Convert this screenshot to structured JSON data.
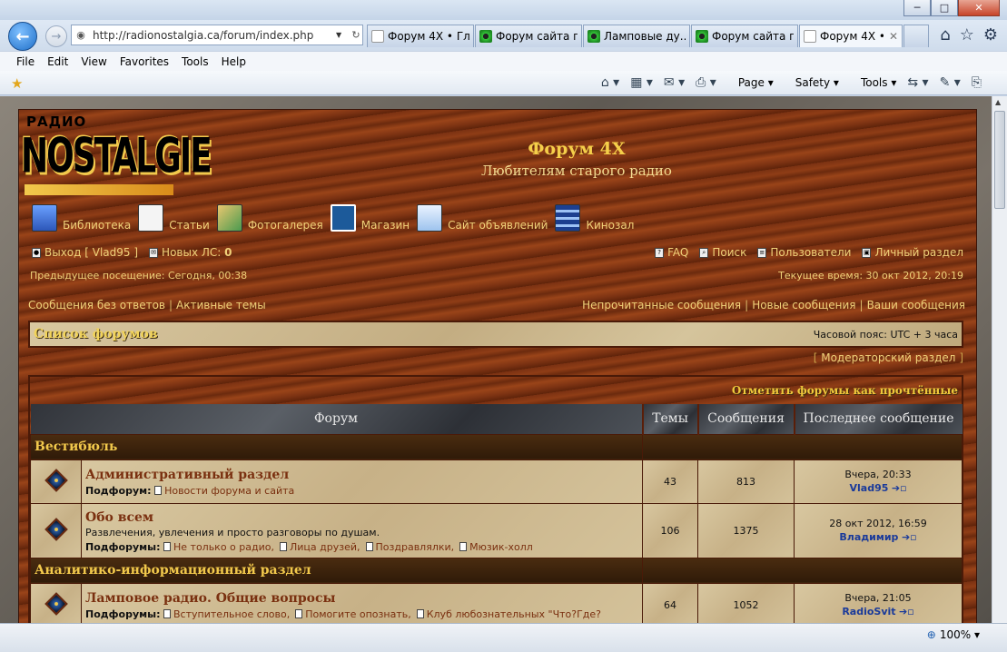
{
  "window": {
    "minimize": "─",
    "maximize": "□",
    "close": "✕"
  },
  "nav": {
    "back": "←",
    "forward": "→",
    "url": "http://radionostalgia.ca/forum/index.php"
  },
  "tabs": [
    {
      "label": "Форум 4Х • Гл...",
      "active": false,
      "fav": "w"
    },
    {
      "label": "Форум сайта г...",
      "active": false,
      "fav": "g"
    },
    {
      "label": "Ламповые ду...",
      "active": false,
      "fav": "g"
    },
    {
      "label": "Форум сайта г...",
      "active": false,
      "fav": "g"
    },
    {
      "label": "Форум 4Х •...",
      "active": true,
      "fav": "w"
    }
  ],
  "menu": [
    "File",
    "Edit",
    "View",
    "Favorites",
    "Tools",
    "Help"
  ],
  "commands": {
    "page": "Page",
    "safety": "Safety",
    "tools": "Tools"
  },
  "site": {
    "logo_small": "РАДИО",
    "logo_big": "NOSTALGIE",
    "title": "Форум 4Х",
    "description": "Любителям старого радио"
  },
  "mainnav": [
    {
      "name": "library",
      "label": "Библиотека",
      "icon": "lib"
    },
    {
      "name": "articles",
      "label": "Статьи",
      "icon": "art"
    },
    {
      "name": "gallery",
      "label": "Фотогалерея",
      "icon": "pho"
    },
    {
      "name": "shop",
      "label": "Магазин",
      "icon": "shop"
    },
    {
      "name": "ads",
      "label": "Сайт объявлений",
      "icon": "ads"
    },
    {
      "name": "cinema",
      "label": "Кинозал",
      "icon": "film"
    }
  ],
  "userbar": {
    "logout": "Выход [ Vlad95 ]",
    "new_pm_label": "Новых ЛС:",
    "new_pm_count": "0",
    "faq": "FAQ",
    "search": "Поиск",
    "members": "Пользователи",
    "ucp": "Личный раздел"
  },
  "visits": {
    "last_visit": "Предыдущее посещение: Сегодня, 00:38",
    "current_time": "Текущее время: 30 окт 2012, 20:19"
  },
  "quicklinks": {
    "unanswered": "Сообщения без ответов",
    "active": "Активные темы",
    "unread": "Непрочитанные сообщения",
    "new": "Новые сообщения",
    "own": "Ваши сообщения"
  },
  "crumbs": {
    "title": "Список форумов",
    "timezone": "Часовой пояс: UTC + 3 часа"
  },
  "moderator_link": "Модераторский раздел",
  "mark_read": "Отметить форумы как прочтённые",
  "table": {
    "headers": [
      "Форум",
      "Темы",
      "Сообщения",
      "Последнее сообщение"
    ],
    "cat1": "Вестибюль",
    "cat2": "Аналитико-информационный раздел",
    "forums": [
      {
        "name": "Административный раздел",
        "desc": "",
        "subs_label": "Подфорум:",
        "subs": [
          "Новости форума и сайта"
        ],
        "topics": "43",
        "posts": "813",
        "last_time": "Вчера, 20:33",
        "last_user": "Vlad95"
      },
      {
        "name": "Обо всем",
        "desc": "Развлечения, увлечения и просто разговоры по душам.",
        "subs_label": "Подфорумы:",
        "subs": [
          "Не только о радио",
          "Лица друзей",
          "Поздравлялки",
          "Мюзик-холл"
        ],
        "topics": "106",
        "posts": "1375",
        "last_time": "28 окт 2012, 16:59",
        "last_user": "Владимир"
      },
      {
        "name": "Ламповое радио. Общие вопросы",
        "desc": "",
        "subs_label": "Подфорумы:",
        "subs": [
          "Вступительное слово",
          "Помогите опознать",
          "Клуб любознательных \"Что?Где?"
        ],
        "topics": "64",
        "posts": "1052",
        "last_time": "Вчера, 21:05",
        "last_user": "RadioSvit"
      }
    ]
  },
  "status": {
    "zoom": "100%"
  },
  "colors": {
    "accent_gold": "#f2c94c",
    "wood": "#7a3112",
    "link_blue": "#1a3a9a"
  }
}
